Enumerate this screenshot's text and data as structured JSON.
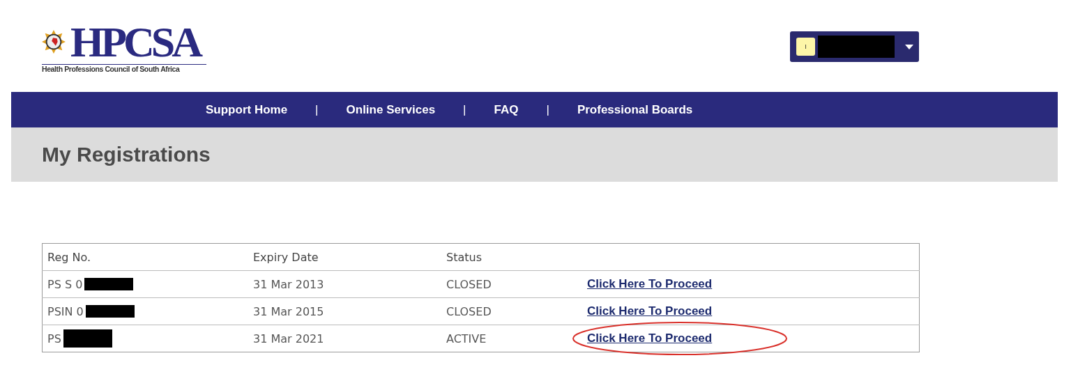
{
  "logo": {
    "title": "HPCSA",
    "subtitle": "Health Professions Council of South Africa"
  },
  "user_menu": {
    "initial": "I"
  },
  "nav": [
    "Support Home",
    "Online Services",
    "FAQ",
    "Professional Boards"
  ],
  "nav_separator": "|",
  "page_title": "My Registrations",
  "table": {
    "columns": [
      "Reg No.",
      "Expiry Date",
      "Status"
    ],
    "rows": [
      {
        "reg_no": "PS S 0",
        "expiry": "31 Mar 2013",
        "status": "CLOSED",
        "link": "Click Here To Proceed",
        "circled": false
      },
      {
        "reg_no": "PSIN 0",
        "expiry": "31 Mar 2015",
        "status": "CLOSED",
        "link": "Click Here To Proceed",
        "circled": false
      },
      {
        "reg_no": "PS",
        "expiry": "31 Mar 2021",
        "status": "ACTIVE",
        "link": "Click Here To Proceed",
        "circled": true
      }
    ]
  }
}
